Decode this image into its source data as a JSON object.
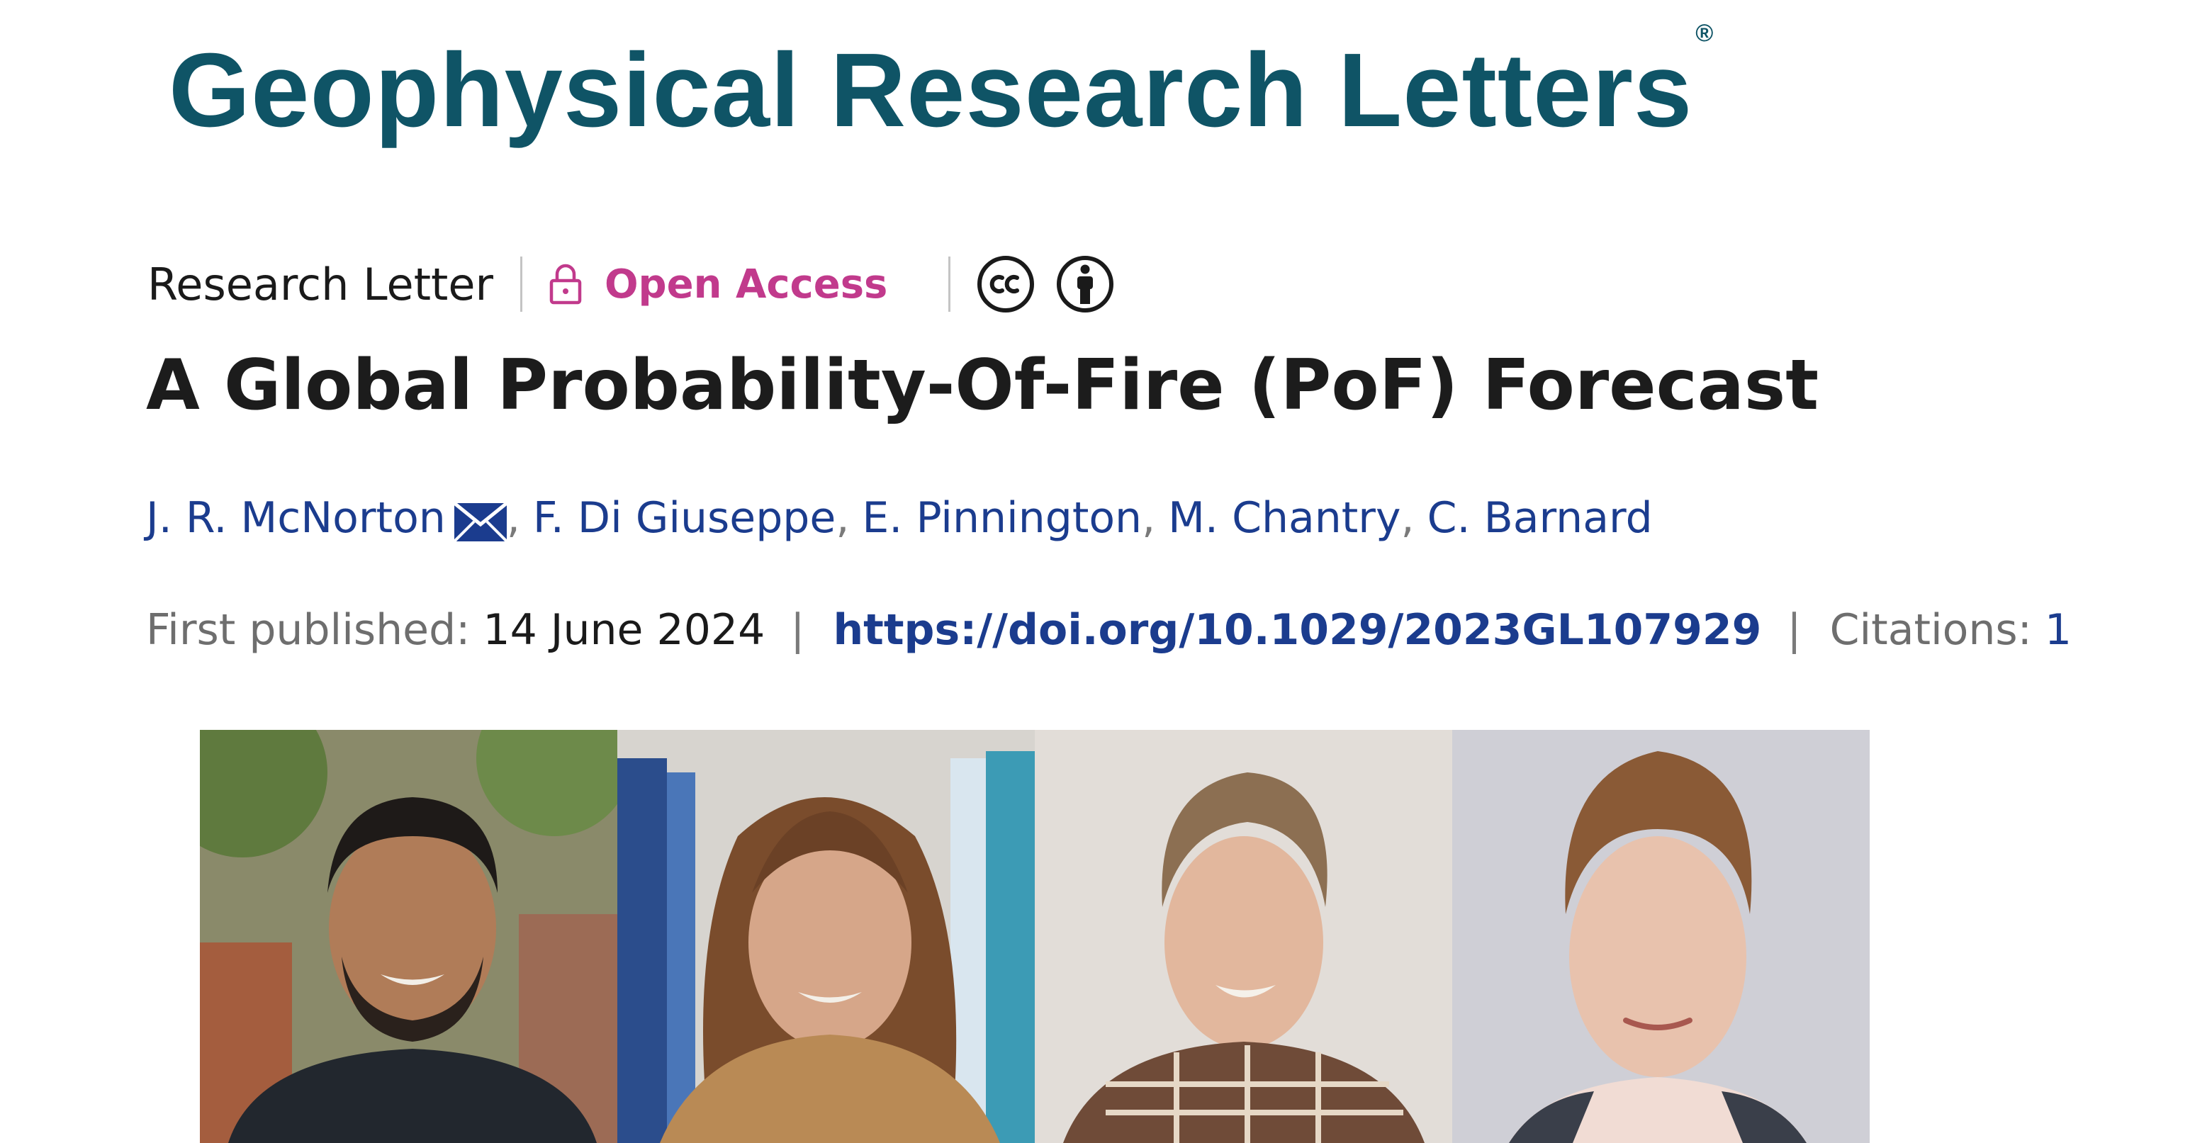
{
  "journal": {
    "name": "Geophysical Research Letters",
    "registered_mark": "®"
  },
  "meta": {
    "article_type": "Research Letter",
    "access_label": "Open Access",
    "access_color": "#c13a8c",
    "icons": [
      "lock-icon",
      "creative-commons-icon",
      "attribution-icon"
    ]
  },
  "article": {
    "title": "A Global Probability-Of-Fire (PoF) Forecast"
  },
  "authors": [
    {
      "name": "J. R. McNorton",
      "corresponding": true
    },
    {
      "name": "F. Di Giuseppe"
    },
    {
      "name": "E. Pinnington"
    },
    {
      "name": "M. Chantry"
    },
    {
      "name": "C. Barnard"
    }
  ],
  "author_separator": ",",
  "publication": {
    "first_published_label": "First published:",
    "first_published_date": "14 June 2024",
    "separator": "|",
    "doi": "https://doi.org/10.1029/2023GL107929",
    "citations_label": "Citations:",
    "citations_count": "1"
  },
  "colors": {
    "journal_teal": "#0f5466",
    "link_blue": "#1b3c8e",
    "text_dark": "#1c1c1c",
    "text_gray": "#6e6e6e"
  }
}
